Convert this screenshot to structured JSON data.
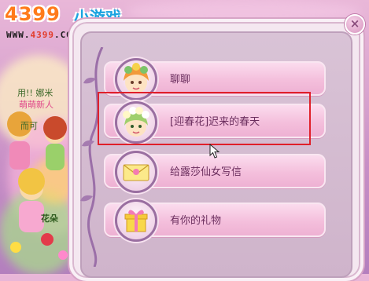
{
  "logo": {
    "number": "4399",
    "name": "小游戏",
    "url_prefix": "WWW.",
    "url_number": "4399",
    "url_suffix": ".COM"
  },
  "background_text": {
    "name_label": "用!! 娜米",
    "status_label": "萌萌新人",
    "player_label": "而可",
    "area_label": "花朵"
  },
  "dialog": {
    "close_label": "×",
    "menu_items": [
      {
        "label": "聊聊",
        "icon": "girl-avatar-icon"
      },
      {
        "label": "[迎春花]迟来的春天",
        "icon": "flower-girl-avatar-icon"
      },
      {
        "label": "给露莎仙女写信",
        "icon": "letter-icon"
      },
      {
        "label": "有你的礼物",
        "icon": "gift-icon"
      }
    ]
  },
  "colors": {
    "highlight_border": "#e0202a",
    "panel_bg": "#f4e7f0",
    "button_pink": "#f4bfdc"
  }
}
